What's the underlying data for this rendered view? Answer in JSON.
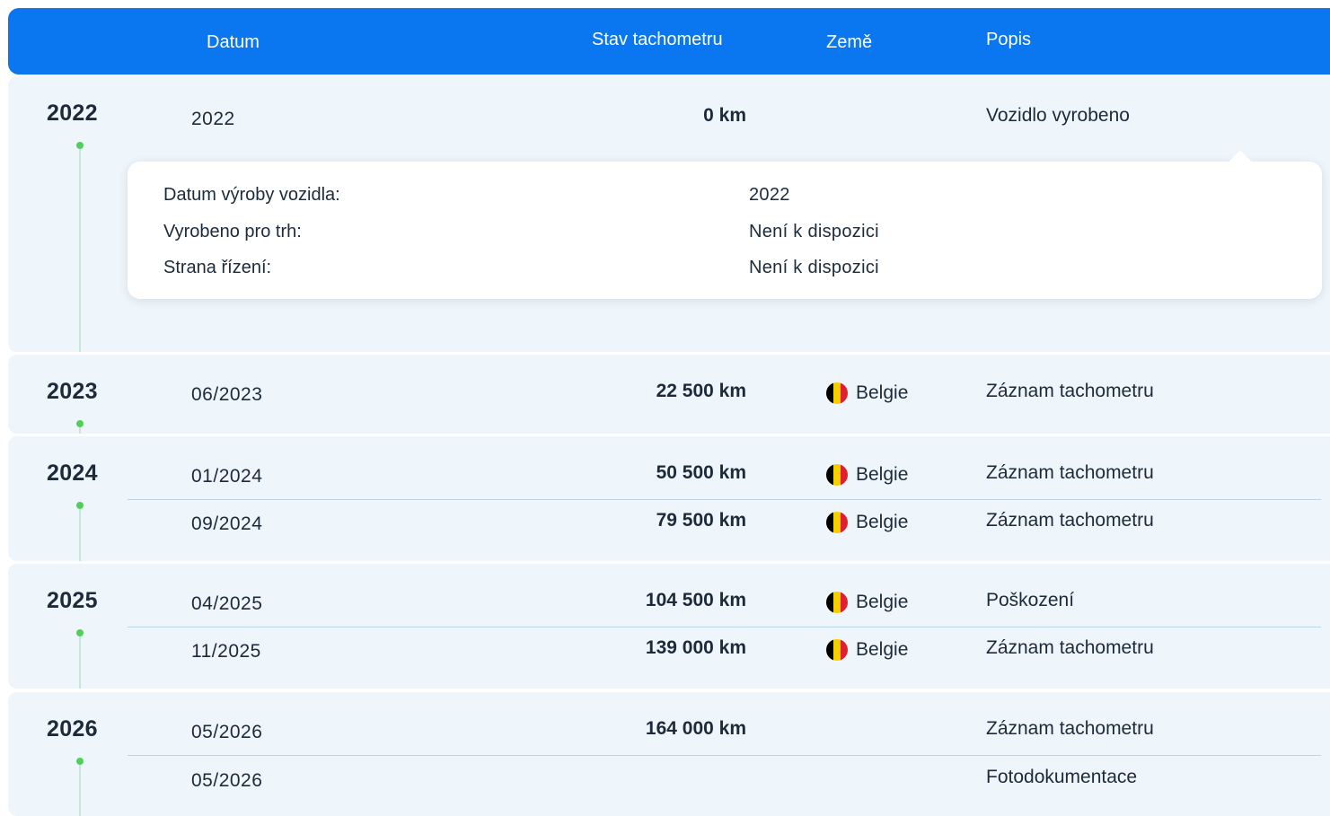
{
  "header": {
    "date": "Datum",
    "odometer": "Stav tachometru",
    "country": "Země",
    "description": "Popis"
  },
  "flag_colors": [
    "#000000",
    "#f5d000",
    "#e0202c"
  ],
  "accent_color": "#0a76f0",
  "timeline": [
    {
      "year": "2022",
      "rows": [
        {
          "date": "2022",
          "odometer": "0 km",
          "country": "",
          "description": "Vozidlo vyrobeno"
        }
      ],
      "details": [
        {
          "label": "Datum výroby vozidla:",
          "value": "2022"
        },
        {
          "label": "Vyrobeno pro trh:",
          "value": "Není k dispozici"
        },
        {
          "label": "Strana řízení:",
          "value": "Není k dispozici"
        }
      ]
    },
    {
      "year": "2023",
      "rows": [
        {
          "date": "06/2023",
          "odometer": "22 500 km",
          "country": "Belgie",
          "description": "Záznam tachometru"
        }
      ]
    },
    {
      "year": "2024",
      "rows": [
        {
          "date": "01/2024",
          "odometer": "50 500 km",
          "country": "Belgie",
          "description": "Záznam tachometru"
        },
        {
          "date": "09/2024",
          "odometer": "79 500 km",
          "country": "Belgie",
          "description": "Záznam tachometru"
        }
      ]
    },
    {
      "year": "2025",
      "rows": [
        {
          "date": "04/2025",
          "odometer": "104 500 km",
          "country": "Belgie",
          "description": "Poškození"
        },
        {
          "date": "11/2025",
          "odometer": "139 000 km",
          "country": "Belgie",
          "description": "Záznam tachometru"
        }
      ]
    },
    {
      "year": "2026",
      "rows": [
        {
          "date": "05/2026",
          "odometer": "164 000 km",
          "country": "",
          "description": "Záznam tachometru"
        },
        {
          "date": "05/2026",
          "odometer": "",
          "country": "",
          "description": "Fotodokumentace"
        }
      ]
    }
  ]
}
